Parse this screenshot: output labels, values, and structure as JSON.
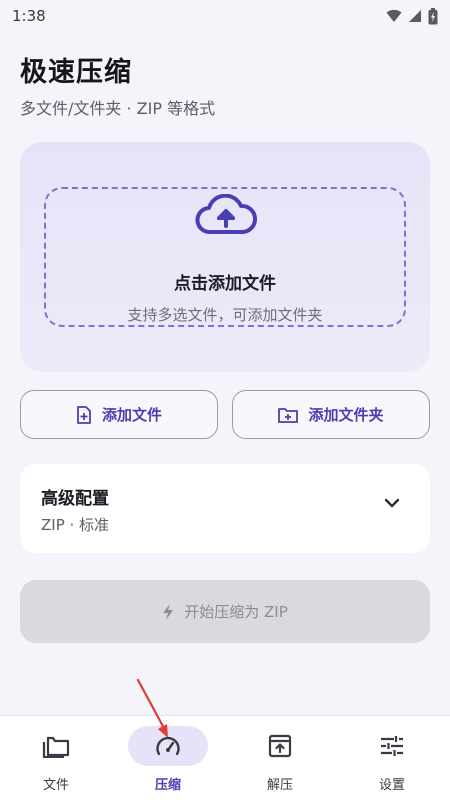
{
  "status_bar": {
    "time": "1:38",
    "icons": [
      "wifi-icon",
      "signal-icon",
      "battery-icon"
    ]
  },
  "header": {
    "title": "极速压缩",
    "subtitle": "多文件/文件夹 · ZIP 等格式"
  },
  "drop_area": {
    "icon": "cloud-upload-icon",
    "title": "点击添加文件",
    "hint": "支持多选文件，可添加文件夹"
  },
  "actions": {
    "add_file": {
      "label": "添加文件",
      "icon": "file-add-icon"
    },
    "add_folder": {
      "label": "添加文件夹",
      "icon": "folder-add-icon"
    }
  },
  "config": {
    "title": "高级配置",
    "summary": "ZIP · 标准",
    "icon": "chevron-down-icon"
  },
  "start_button": {
    "label": "开始压缩为 ZIP",
    "icon": "lightning-icon",
    "enabled": false
  },
  "bottom_nav": {
    "active": "压缩",
    "items": [
      {
        "label": "文件",
        "icon": "folder-icon"
      },
      {
        "label": "压缩",
        "icon": "speedometer-icon"
      },
      {
        "label": "解压",
        "icon": "archive-upload-icon"
      },
      {
        "label": "设置",
        "icon": "sliders-icon"
      }
    ]
  },
  "colors": {
    "accent": "#4a3fb0",
    "dash_border": "#7c72d6",
    "annotation": "#e53935",
    "disabled_bg": "#d9d9de"
  }
}
